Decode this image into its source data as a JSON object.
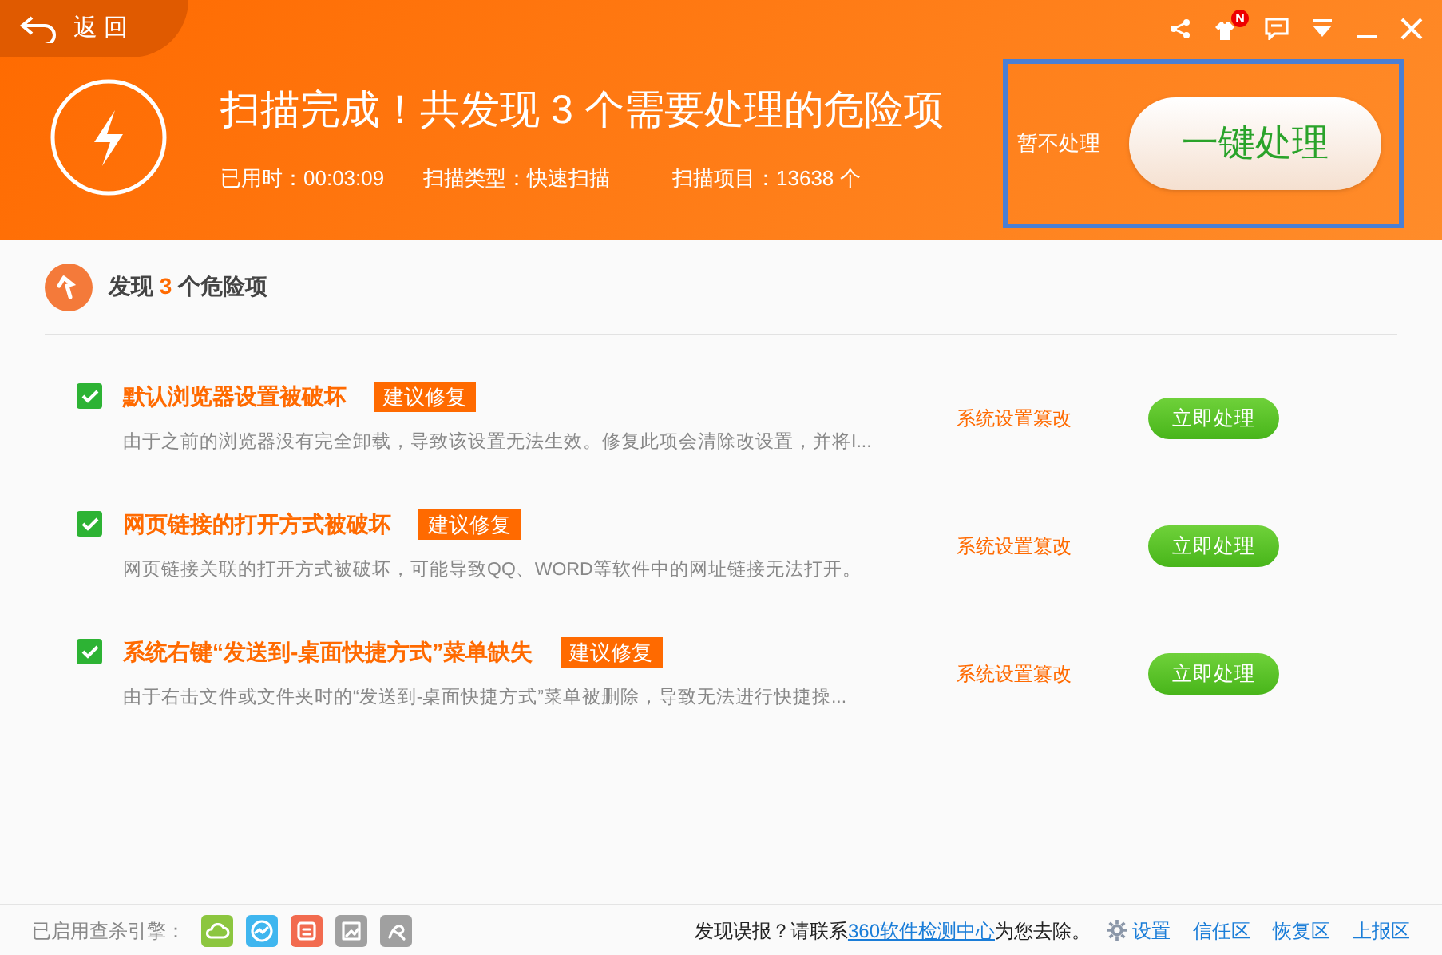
{
  "back": {
    "label": "返 回"
  },
  "header": {
    "title": "扫描完成！共发现 3 个需要处理的危险项",
    "stats": [
      "已用时：00:03:09",
      "扫描类型：快速扫描",
      "扫描项目：13638 个"
    ],
    "skip": "暂不处理",
    "fix_all": "一键处理",
    "notification_badge": "N"
  },
  "section": {
    "prefix": "发现",
    "count": "3",
    "suffix": "个危险项"
  },
  "items": [
    {
      "checked": true,
      "title": "默认浏览器设置被破坏",
      "tag": "建议修复",
      "description": "由于之前的浏览器没有完全卸载，导致该设置无法生效。修复此项会清除改设置，并将I...",
      "category": "系统设置篡改",
      "action": "立即处理"
    },
    {
      "checked": true,
      "title": "网页链接的打开方式被破坏",
      "tag": "建议修复",
      "description": "网页链接关联的打开方式被破坏，可能导致QQ、WORD等软件中的网址链接无法打开。",
      "category": "系统设置篡改",
      "action": "立即处理"
    },
    {
      "checked": true,
      "title": "系统右键“发送到-桌面快捷方式”菜单缺失",
      "tag": "建议修复",
      "description": "由于右击文件或文件夹时的“发送到-桌面快捷方式”菜单被删除，导致无法进行快捷操...",
      "category": "系统设置篡改",
      "action": "立即处理"
    }
  ],
  "footer": {
    "engines_label": "已启用查杀引擎：",
    "engines": [
      {
        "kind": "cloud",
        "color": "#8cc63f"
      },
      {
        "kind": "pulse",
        "color": "#3fb6ef"
      },
      {
        "kind": "doc",
        "color": "#f26b4f"
      },
      {
        "kind": "chart",
        "color": "#a0a0a0"
      },
      {
        "kind": "swirl",
        "color": "#a0a0a0"
      }
    ],
    "report_prefix": "发现误报？请联系",
    "report_link": "360软件检测中心",
    "report_suffix": "为您去除。",
    "links": [
      "设置",
      "信任区",
      "恢复区",
      "上报区"
    ]
  }
}
